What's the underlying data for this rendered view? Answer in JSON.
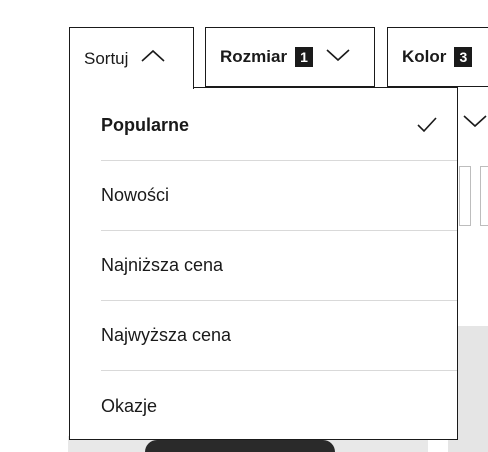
{
  "filters": {
    "sort_label": "Sortuj",
    "size_label": "Rozmiar",
    "size_count": "1",
    "color_label": "Kolor",
    "color_count": "3"
  },
  "sort_options": [
    {
      "label": "Popularne",
      "selected": true
    },
    {
      "label": "Nowości",
      "selected": false
    },
    {
      "label": "Najniższa cena",
      "selected": false
    },
    {
      "label": "Najwyższa cena",
      "selected": false
    },
    {
      "label": "Okazje",
      "selected": false
    }
  ],
  "icons": {
    "sort_open": "chevron-up-icon",
    "size_dropdown": "chevron-down-icon",
    "selected_mark": "check-icon"
  }
}
